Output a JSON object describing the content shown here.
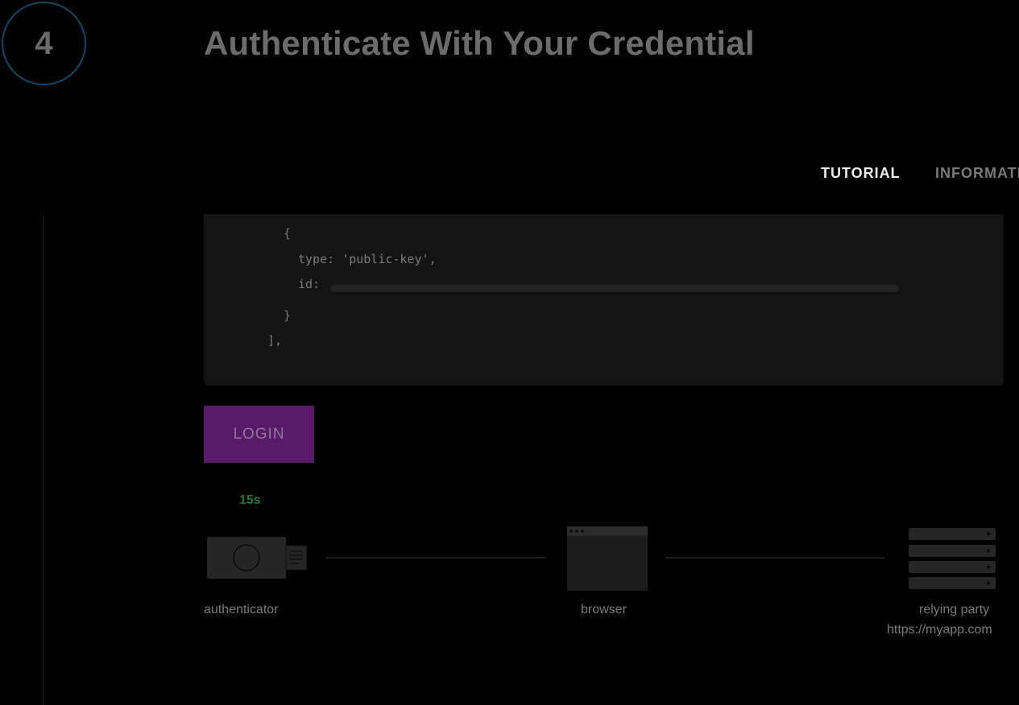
{
  "step": {
    "number": "4",
    "title": "Authenticate With Your Credential"
  },
  "tabs": [
    {
      "label": "TUTORIAL",
      "active": true
    },
    {
      "label": "INFORMATION",
      "active": false
    }
  ],
  "code": {
    "lines": {
      "open_brace": "{",
      "type_key": "type: ",
      "type_value": "'public-key',",
      "id_key": "id:",
      "close_brace": "}",
      "close_array": "],"
    }
  },
  "login": {
    "button_label": "LOGIN",
    "timer_text": "15s"
  },
  "diagram": {
    "authenticator_label": "authenticator",
    "browser_label": "browser",
    "relying_party_label": "relying party",
    "relying_party_url": "https://myapp.com"
  },
  "colors": {
    "background": "#000000",
    "step_ring": "#0d4a66",
    "login_button": "#5a1a6b",
    "timer": "#1f7a2e",
    "code_background": "#141414"
  },
  "icons": {
    "authenticator": "security-key-icon",
    "browser": "browser-window-icon",
    "relying_party": "server-rack-icon"
  }
}
